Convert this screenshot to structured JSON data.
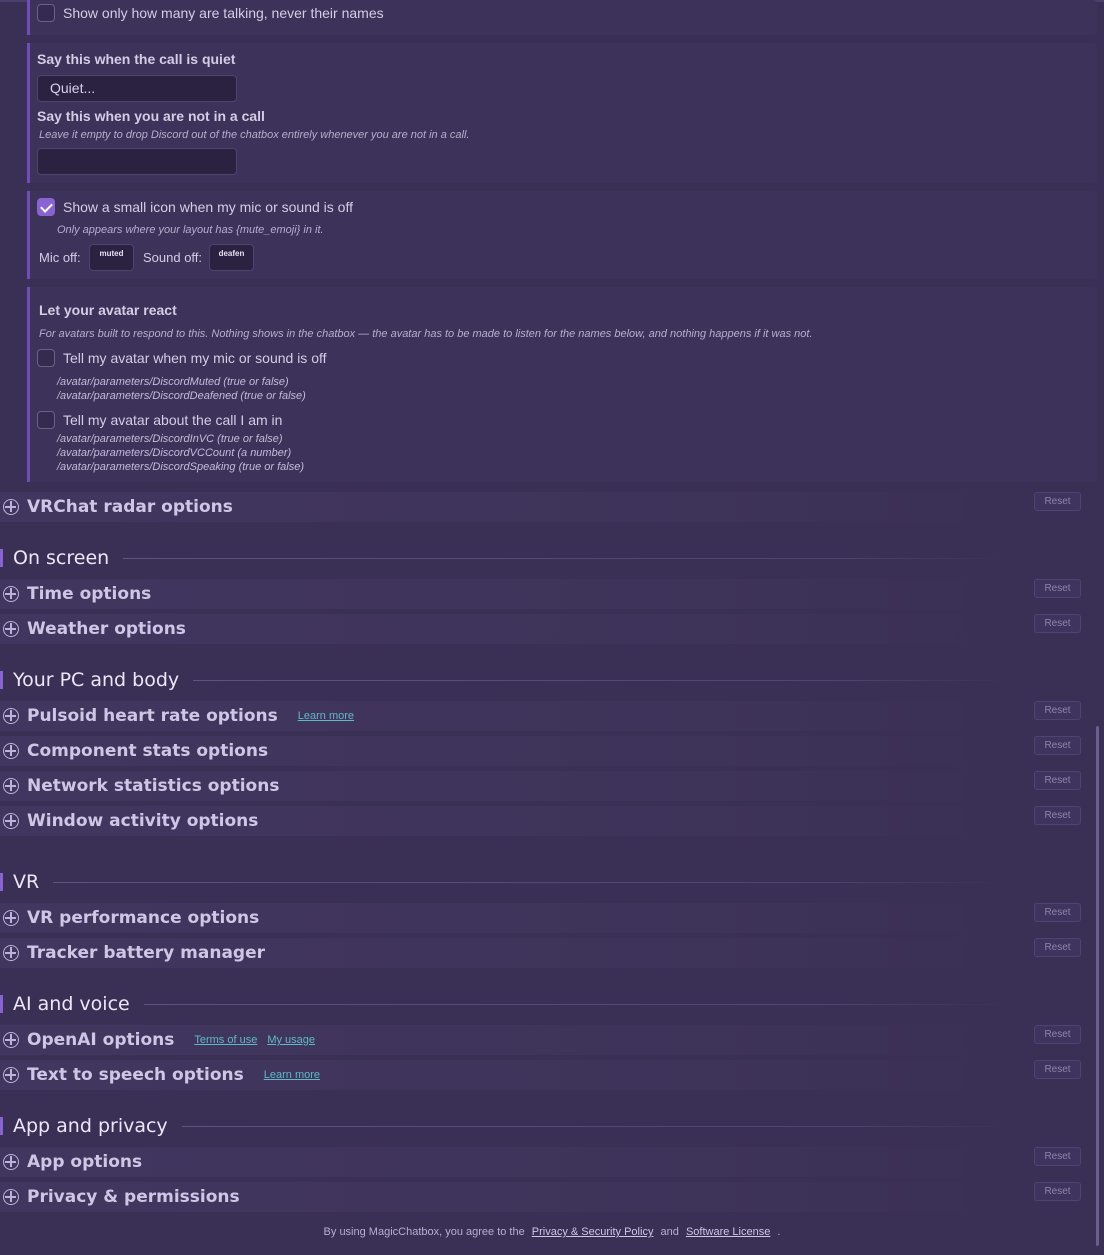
{
  "discord": {
    "count_only_label": "Show only how many are talking, never their names",
    "quiet_title": "Say this when the call is quiet",
    "quiet_value": "Quiet...",
    "not_in_call_title": "Say this when you are not in a call",
    "not_in_call_hint": "Leave it empty to drop Discord out of the chatbox entirely whenever you are not in a call.",
    "not_in_call_value": "",
    "mute_icon_label": "Show a small icon when my mic or sound is off",
    "mute_icon_checked": true,
    "mute_icon_hint": "Only appears where your layout has {mute_emoji} in it.",
    "mic_off_label": "Mic off:",
    "mic_off_value": "muted",
    "sound_off_label": "Sound off:",
    "sound_off_value": "deafen",
    "avatar_title": "Let your avatar react",
    "avatar_hint": "For avatars built to respond to this. Nothing shows in the chatbox — the avatar has to be made to listen for the names below, and nothing happens if it was not.",
    "avatar_mute_label": "Tell my avatar when my mic or sound is off",
    "avatar_mute_paths": [
      "/avatar/parameters/DiscordMuted (true or false)",
      "/avatar/parameters/DiscordDeafened (true or false)"
    ],
    "avatar_call_label": "Tell my avatar about the call I am in",
    "avatar_call_paths": [
      "/avatar/parameters/DiscordInVC (true or false)",
      "/avatar/parameters/DiscordVCCount (a number)",
      "/avatar/parameters/DiscordSpeaking (true or false)"
    ]
  },
  "reset_label": "Reset",
  "sections": {
    "vrchat_radar": "VRChat radar options",
    "time": "Time options",
    "weather": "Weather options",
    "pulsoid": "Pulsoid heart rate options",
    "pulsoid_link": "Learn more",
    "component_stats": "Component stats options",
    "network": "Network statistics options",
    "window_activity": "Window activity options",
    "vr_performance": "VR performance options",
    "tracker_battery": "Tracker battery manager",
    "openai": "OpenAI options",
    "openai_terms": "Terms of use",
    "openai_usage": "My usage",
    "tts": "Text to speech options",
    "tts_link": "Learn more",
    "app": "App options",
    "privacy": "Privacy & permissions"
  },
  "groups": {
    "on_screen": "On screen",
    "pc_body": "Your PC and body",
    "vr": "VR",
    "ai_voice": "AI and voice",
    "app_privacy": "App and privacy"
  },
  "footer": {
    "prefix": "By using MagicChatbox, you agree to the",
    "privacy_link": "Privacy & Security Policy",
    "and": "and",
    "license_link": "Software License",
    "suffix": "."
  }
}
